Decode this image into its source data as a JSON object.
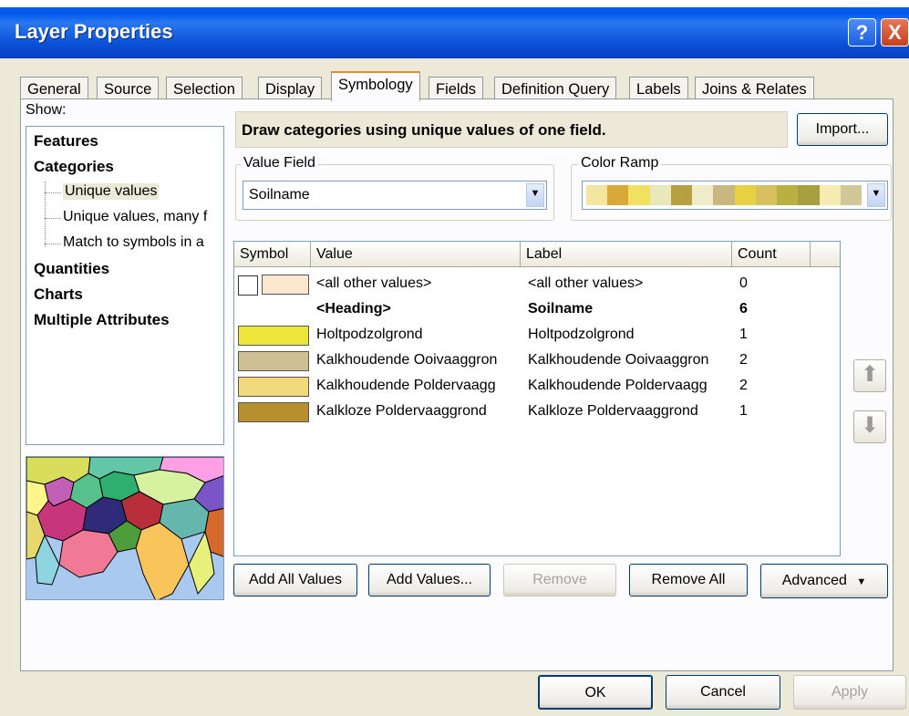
{
  "window": {
    "title": "Layer Properties"
  },
  "titlebar_buttons": {
    "help": "?",
    "close": "X"
  },
  "tabs": [
    "General",
    "Source",
    "Selection",
    "Display",
    "Symbology",
    "Fields",
    "Definition Query",
    "Labels",
    "Joins & Relates"
  ],
  "active_tab": "Symbology",
  "show": {
    "label": "Show:",
    "items": [
      {
        "label": "Features"
      },
      {
        "label": "Categories"
      },
      {
        "label": "Unique values"
      },
      {
        "label": "Unique values, many f"
      },
      {
        "label": "Match to symbols in a"
      },
      {
        "label": "Quantities"
      },
      {
        "label": "Charts"
      },
      {
        "label": "Multiple Attributes"
      }
    ],
    "selected": "Unique values"
  },
  "description": "Draw categories using unique values of one field.",
  "import_button": "Import...",
  "value_field": {
    "label": "Value Field",
    "value": "Soilname"
  },
  "color_ramp": {
    "label": "Color Ramp",
    "colors": [
      "#f2e6a0",
      "#d8a838",
      "#f2e060",
      "#e8e8b8",
      "#b8a040",
      "#f0ecc8",
      "#c8b880",
      "#e8d040",
      "#d8c060",
      "#b8b040",
      "#a8a040",
      "#f4ecb0",
      "#d0c898"
    ]
  },
  "table": {
    "headers": [
      "Symbol",
      "Value",
      "Label",
      "Count"
    ],
    "rows": [
      {
        "value": "<all other values>",
        "label": "<all other values>",
        "count": "0",
        "color": "#fbe8cf",
        "bold": false
      },
      {
        "value": "<Heading>",
        "label": "Soilname",
        "count": "6",
        "color": "",
        "bold": true
      },
      {
        "value": "Holtpodzolgrond",
        "label": "Holtpodzolgrond",
        "count": "1",
        "color": "#ece63a",
        "bold": false
      },
      {
        "value": "Kalkhoudende Ooivaaggron",
        "label": "Kalkhoudende Ooivaaggron",
        "count": "2",
        "color": "#cdc093",
        "bold": false
      },
      {
        "value": "Kalkhoudende Poldervaagg",
        "label": "Kalkhoudende Poldervaagg",
        "count": "2",
        "color": "#f2d97c",
        "bold": false
      },
      {
        "value": "Kalkloze Poldervaaggrond",
        "label": "Kalkloze Poldervaaggrond",
        "count": "1",
        "color": "#b7902d",
        "bold": false
      }
    ]
  },
  "buttons": {
    "add_all": "Add All Values",
    "add_values": "Add Values...",
    "remove": "Remove",
    "remove_all": "Remove All",
    "advanced": "Advanced",
    "ok": "OK",
    "cancel": "Cancel",
    "apply": "Apply"
  },
  "move_buttons": {
    "up": "⬆",
    "down": "⬇"
  }
}
